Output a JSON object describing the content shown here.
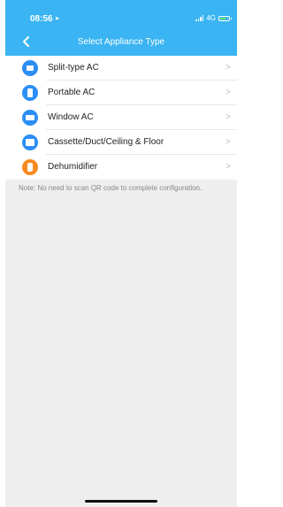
{
  "status_bar": {
    "time": "08:56",
    "network": "4G"
  },
  "header": {
    "title": "Select Appliance Type"
  },
  "appliances": [
    {
      "label": "Split-type AC",
      "icon": "split-ac-icon",
      "color": "#2b8ef5"
    },
    {
      "label": "Portable AC",
      "icon": "portable-ac-icon",
      "color": "#2b8ef5"
    },
    {
      "label": "Window AC",
      "icon": "window-ac-icon",
      "color": "#2b8ef5"
    },
    {
      "label": "Cassette/Duct/Ceiling & Floor",
      "icon": "cassette-ac-icon",
      "color": "#2b8ef5"
    },
    {
      "label": "Dehumidifier",
      "icon": "dehumidifier-icon",
      "color": "#f78a1e"
    }
  ],
  "note": "Note: No need to scan QR code to complete configuration.",
  "colors": {
    "header": "#3ab4f2",
    "background": "#eeeeee",
    "accent_blue": "#2b8ef5",
    "accent_orange": "#f78a1e"
  }
}
